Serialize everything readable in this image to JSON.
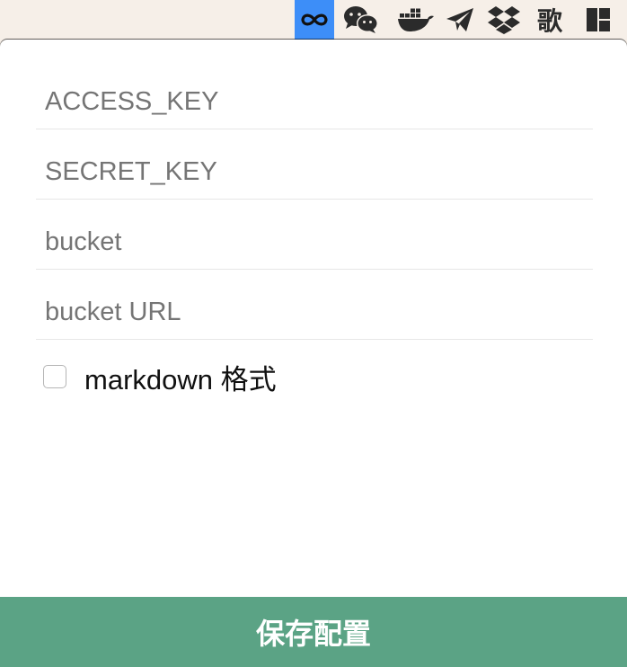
{
  "menubar": {
    "items": [
      {
        "icon": "infinity-icon",
        "active": true
      },
      {
        "icon": "wechat-icon",
        "active": false
      },
      {
        "icon": "docker-icon",
        "active": false
      },
      {
        "icon": "paper-plane-icon",
        "active": false
      },
      {
        "icon": "dropbox-icon",
        "active": false
      },
      {
        "icon": "song-icon",
        "active": false,
        "glyph": "歌"
      },
      {
        "icon": "layout-grid-icon",
        "active": false
      }
    ],
    "accent_color": "#3d8ef8"
  },
  "form": {
    "access_key": {
      "placeholder": "ACCESS_KEY",
      "value": ""
    },
    "secret_key": {
      "placeholder": "SECRET_KEY",
      "value": ""
    },
    "bucket": {
      "placeholder": "bucket",
      "value": ""
    },
    "bucket_url": {
      "placeholder": "bucket URL",
      "value": ""
    },
    "markdown": {
      "label": "markdown 格式",
      "checked": false
    },
    "save_label": "保存配置"
  },
  "colors": {
    "save_button": "#5ba385",
    "menubar_bg": "#f6efe8"
  }
}
